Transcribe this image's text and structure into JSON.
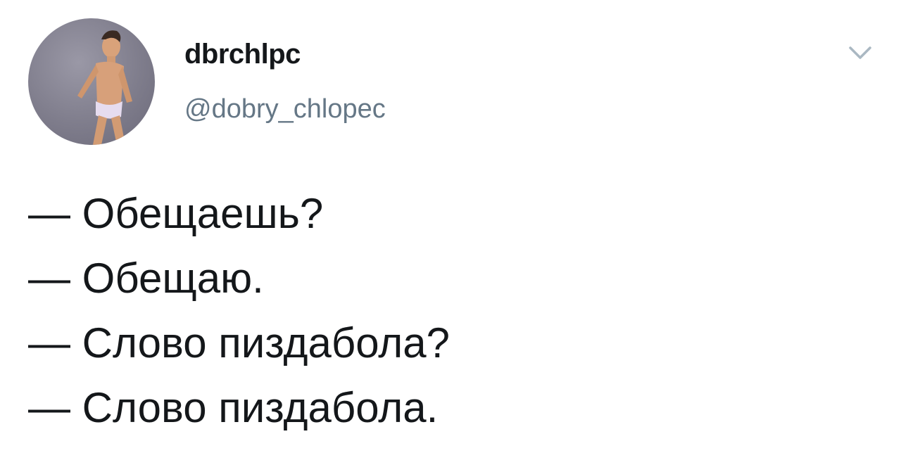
{
  "author": {
    "display_name": "dbrchlpc",
    "handle": "@dobry_chlopec"
  },
  "menu": {
    "icon": "chevron-down-icon"
  },
  "tweet": {
    "lines": [
      "— Обещаешь?",
      "— Обещаю.",
      "— Слово пиздабола?",
      "— Слово пиздабола."
    ]
  },
  "colors": {
    "text_primary": "#14171a",
    "text_secondary": "#657786",
    "caret": "#aab8c2",
    "background": "#ffffff"
  }
}
